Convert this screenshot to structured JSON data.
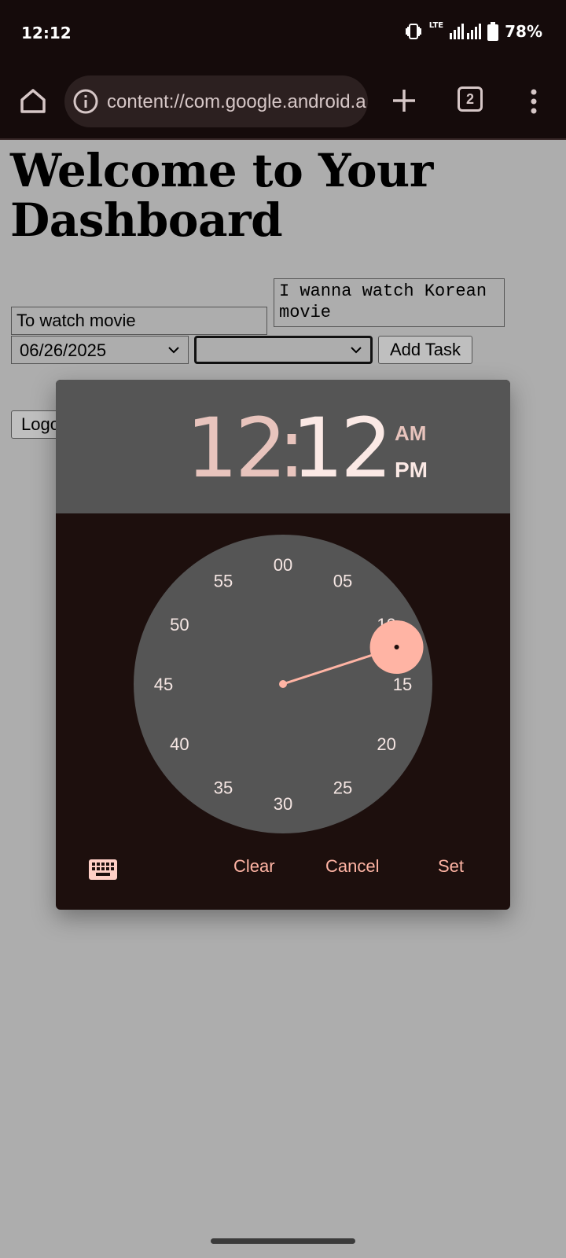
{
  "status_bar": {
    "time": "12:12",
    "network": "LTE",
    "battery": "78%"
  },
  "browser": {
    "url": "content://com.google.android.apps.docs.storage/",
    "tab_count": "2"
  },
  "page": {
    "title": "Welcome to Your Dashboard",
    "task_input_value": "To watch movie",
    "notes_value": "I wanna watch Korean movie",
    "date_value": "06/26/2025",
    "priority_value": "",
    "add_task_label": "Add Task",
    "logout_label": "Logout"
  },
  "time_picker": {
    "hour": "12",
    "separator": ":",
    "minute": "12",
    "am_label": "AM",
    "pm_label": "PM",
    "selected_period": "PM",
    "minute_labels": [
      "00",
      "05",
      "10",
      "15",
      "20",
      "25",
      "30",
      "35",
      "40",
      "45",
      "50",
      "55"
    ],
    "selected_minute": 12,
    "clear_label": "Clear",
    "cancel_label": "Cancel",
    "set_label": "Set",
    "keyboard_icon": "keyboard-icon"
  },
  "colors": {
    "accent": "#ffb4a4",
    "dialog_bg": "#1d0f0d",
    "header_bg": "#555555",
    "dial_bg": "#555555",
    "scrim": "#adadad",
    "status_bar_bg": "#150b0b"
  }
}
